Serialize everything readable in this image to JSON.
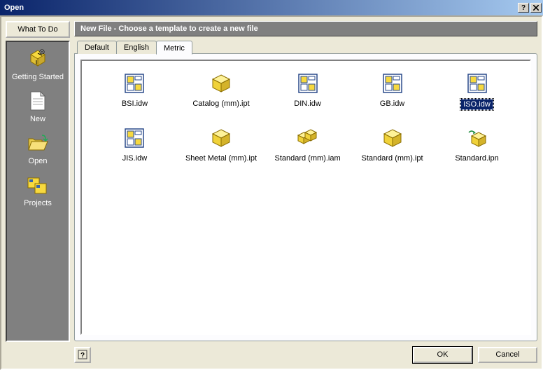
{
  "window": {
    "title": "Open"
  },
  "sidebar": {
    "button": "What To Do",
    "items": [
      {
        "label": "Getting Started",
        "icon": "getting-started"
      },
      {
        "label": "New",
        "icon": "new-doc"
      },
      {
        "label": "Open",
        "icon": "open-folder"
      },
      {
        "label": "Projects",
        "icon": "projects"
      }
    ]
  },
  "heading": "New File - Choose a template to create a new file",
  "tabs": [
    {
      "label": "Default",
      "active": false
    },
    {
      "label": "English",
      "active": false
    },
    {
      "label": "Metric",
      "active": true
    }
  ],
  "files": [
    {
      "name": "BSI.idw",
      "icon": "idw",
      "selected": false
    },
    {
      "name": "Catalog (mm).ipt",
      "icon": "ipt",
      "selected": false
    },
    {
      "name": "DIN.idw",
      "icon": "idw",
      "selected": false
    },
    {
      "name": "GB.idw",
      "icon": "idw",
      "selected": false
    },
    {
      "name": "ISO.idw",
      "icon": "idw",
      "selected": true
    },
    {
      "name": "JIS.idw",
      "icon": "idw",
      "selected": false
    },
    {
      "name": "Sheet Metal (mm).ipt",
      "icon": "ipt",
      "selected": false
    },
    {
      "name": "Standard (mm).iam",
      "icon": "iam",
      "selected": false
    },
    {
      "name": "Standard (mm).ipt",
      "icon": "ipt",
      "selected": false
    },
    {
      "name": "Standard.ipn",
      "icon": "ipn",
      "selected": false
    }
  ],
  "footer": {
    "help_tooltip": "Help",
    "ok": "OK",
    "cancel": "Cancel"
  }
}
